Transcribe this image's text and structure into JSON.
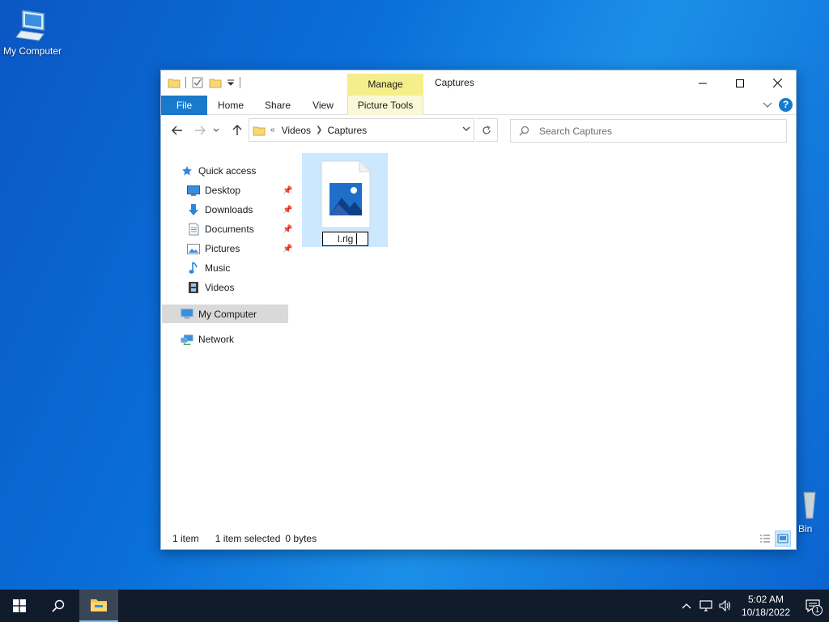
{
  "desktop": {
    "my_computer_label": "My Computer",
    "recycle_bin_label": "Bin"
  },
  "window": {
    "title": "Captures",
    "manage_tab": "Manage",
    "ribbon_tabs": {
      "file": "File",
      "home": "Home",
      "share": "Share",
      "view": "View",
      "picture_tools": "Picture Tools"
    },
    "help_label": "?",
    "address": {
      "overflow": "«",
      "crumbs": [
        "Videos",
        "Captures"
      ]
    },
    "search_placeholder": "Search Captures",
    "nav_pane": {
      "items": [
        {
          "label": "Quick access",
          "icon": "star-icon"
        },
        {
          "label": "Desktop",
          "icon": "desktop-icon",
          "pinned": true
        },
        {
          "label": "Downloads",
          "icon": "download-icon",
          "pinned": true
        },
        {
          "label": "Documents",
          "icon": "document-icon",
          "pinned": true
        },
        {
          "label": "Pictures",
          "icon": "pictures-icon",
          "pinned": true
        },
        {
          "label": "Music",
          "icon": "music-icon"
        },
        {
          "label": "Videos",
          "icon": "video-icon"
        },
        {
          "label": "My Computer",
          "icon": "computer-icon",
          "selected": true
        },
        {
          "label": "Network",
          "icon": "network-icon"
        }
      ]
    },
    "file": {
      "rename_value": "l.rlg"
    },
    "status": {
      "count": "1 item",
      "selection": "1 item selected",
      "size": "0 bytes"
    }
  },
  "taskbar": {
    "time": "5:02 AM",
    "date": "10/18/2022",
    "notification_count": "1"
  },
  "colors": {
    "accent": "#1979ca",
    "selection": "#cce8ff",
    "manage": "#f5ee8a",
    "taskbar": "#101c2c"
  }
}
